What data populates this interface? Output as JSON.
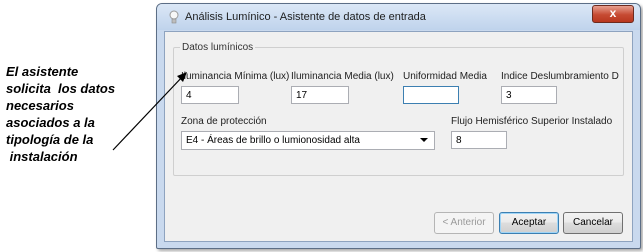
{
  "annotation": {
    "lines": [
      "El asistente",
      "solicita  los datos",
      "necesarios",
      "asociados a la",
      "tipología de la",
      " instalación"
    ]
  },
  "window": {
    "title": "Análisis Lumínico - Asistente de datos de entrada",
    "close_label": "x"
  },
  "group": {
    "legend": "Datos lumínicos",
    "fields": {
      "min_label": "Iluminancia Mínima (lux)",
      "min_value": "4",
      "media_label": "Iluminancia Media (lux)",
      "media_value": "17",
      "uniformidad_label": "Uniformidad Media",
      "uniformidad_value": "",
      "deslumbramiento_label": "Indice Deslumbramiento D",
      "deslumbramiento_value": "3",
      "zona_label": "Zona de protección",
      "zona_value": "E4 - Áreas de brillo o lumionosidad alta",
      "flujo_label": "Flujo Hemisférico Superior Instalado",
      "flujo_value": "8"
    }
  },
  "buttons": {
    "anterior": "< Anterior",
    "aceptar": "Aceptar",
    "cancelar": "Cancelar"
  }
}
